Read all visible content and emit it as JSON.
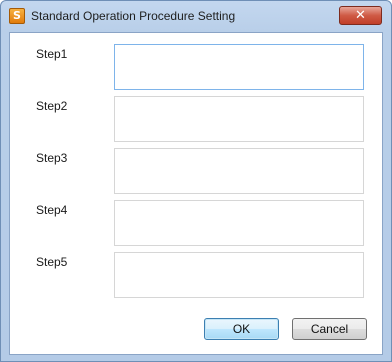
{
  "window": {
    "title": "Standard Operation Procedure Setting",
    "app_icon_glyph": "S",
    "close_glyph": "✕"
  },
  "steps": [
    {
      "label": "Step1",
      "value": ""
    },
    {
      "label": "Step2",
      "value": ""
    },
    {
      "label": "Step3",
      "value": ""
    },
    {
      "label": "Step4",
      "value": ""
    },
    {
      "label": "Step5",
      "value": ""
    }
  ],
  "buttons": {
    "ok_label": "OK",
    "cancel_label": "Cancel"
  },
  "colors": {
    "title_bar": "#b9cfe9",
    "close_button": "#c94a35",
    "focused_field_border": "#7eb4ea"
  }
}
